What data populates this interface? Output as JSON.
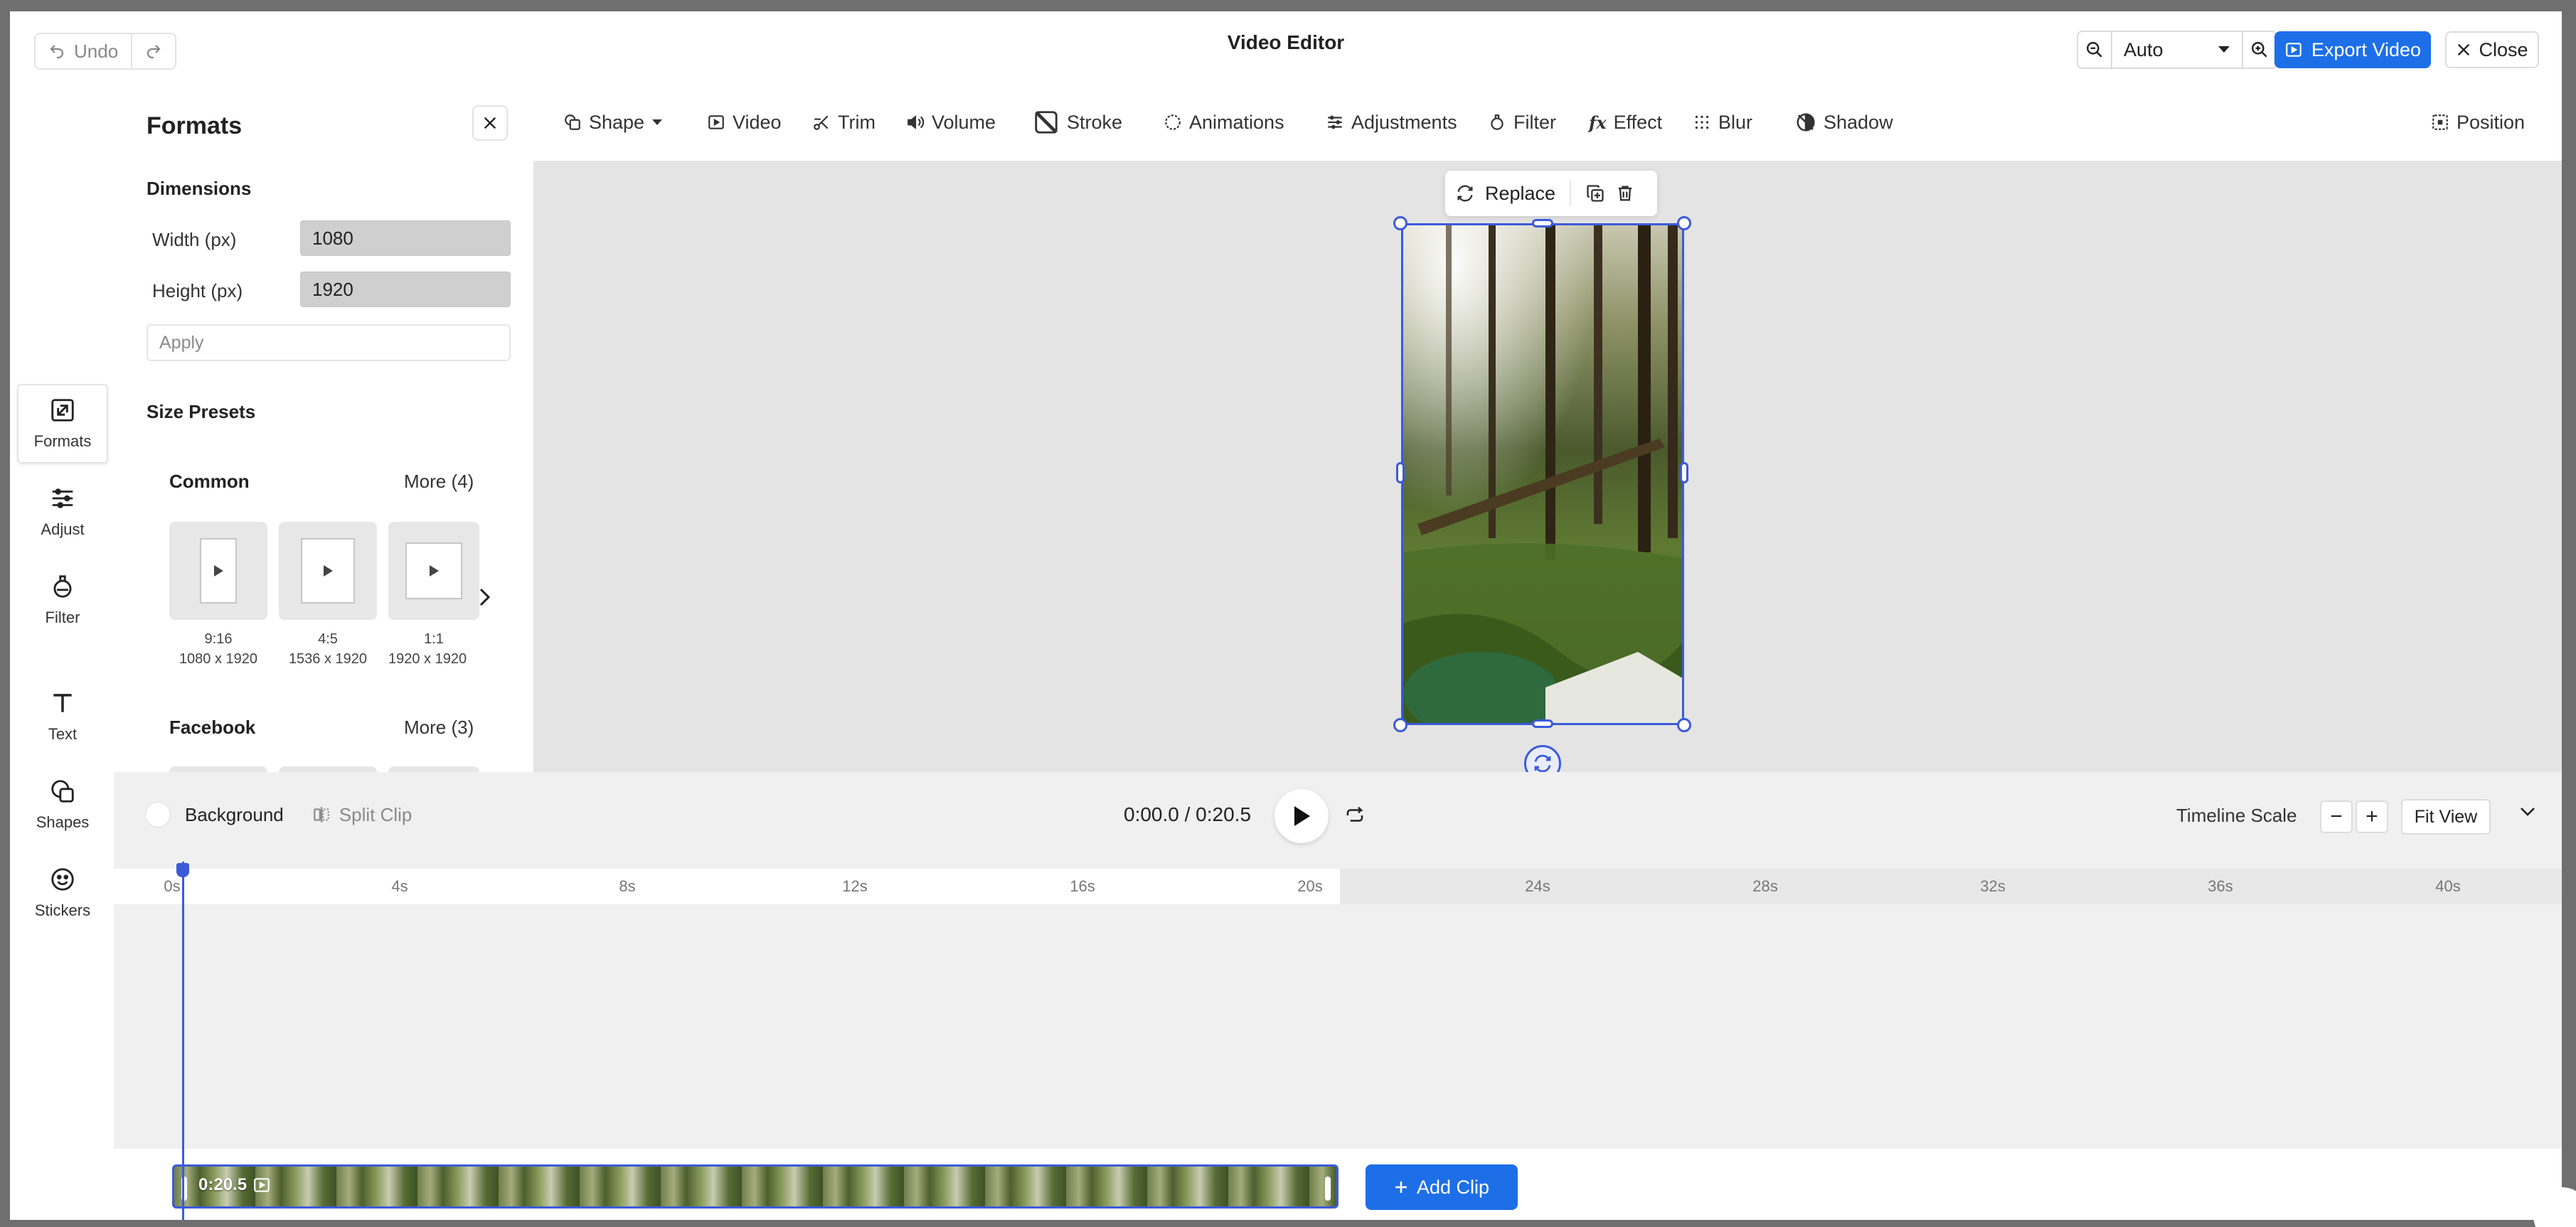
{
  "header": {
    "undo_label": "Undo",
    "title": "Video Editor",
    "zoom_value": "Auto",
    "export_label": "Export Video",
    "close_label": "Close"
  },
  "rail": {
    "items": [
      {
        "label": "Formats"
      },
      {
        "label": "Adjust"
      },
      {
        "label": "Filter"
      },
      {
        "label": "Text"
      },
      {
        "label": "Shapes"
      },
      {
        "label": "Stickers"
      }
    ]
  },
  "panel": {
    "title": "Formats",
    "dimensions_title": "Dimensions",
    "width_label": "Width (px)",
    "width_value": "1080",
    "height_label": "Height (px)",
    "height_value": "1920",
    "apply_label": "Apply",
    "presets_title": "Size Presets",
    "common_title": "Common",
    "common_more": "More (4)",
    "presets": [
      {
        "name": "9:16",
        "size": "1080 x 1920"
      },
      {
        "name": "4:5",
        "size": "1536 x 1920"
      },
      {
        "name": "1:1",
        "size": "1920 x 1920"
      }
    ],
    "facebook_title": "Facebook",
    "facebook_more": "More (3)"
  },
  "toolbar": {
    "shape": "Shape",
    "video": "Video",
    "trim": "Trim",
    "volume": "Volume",
    "stroke": "Stroke",
    "animations": "Animations",
    "adjustments": "Adjustments",
    "filter": "Filter",
    "effect": "Effect",
    "blur": "Blur",
    "shadow": "Shadow",
    "position": "Position"
  },
  "canvas": {
    "replace_label": "Replace"
  },
  "timeline": {
    "background_label": "Background",
    "split_label": "Split Clip",
    "time_readout": "0:00.0 / 0:20.5",
    "scale_label": "Timeline Scale",
    "minus": "−",
    "plus": "+",
    "fit_view": "Fit View",
    "ticks": [
      "0s",
      "4s",
      "8s",
      "12s",
      "16s",
      "20s",
      "24s",
      "28s",
      "32s",
      "36s",
      "40s"
    ],
    "clip_duration": "0:20.5",
    "add_clip_label": "Add Clip"
  },
  "colors": {
    "accent": "#1d6fe8",
    "selection": "#3b5bdb"
  }
}
